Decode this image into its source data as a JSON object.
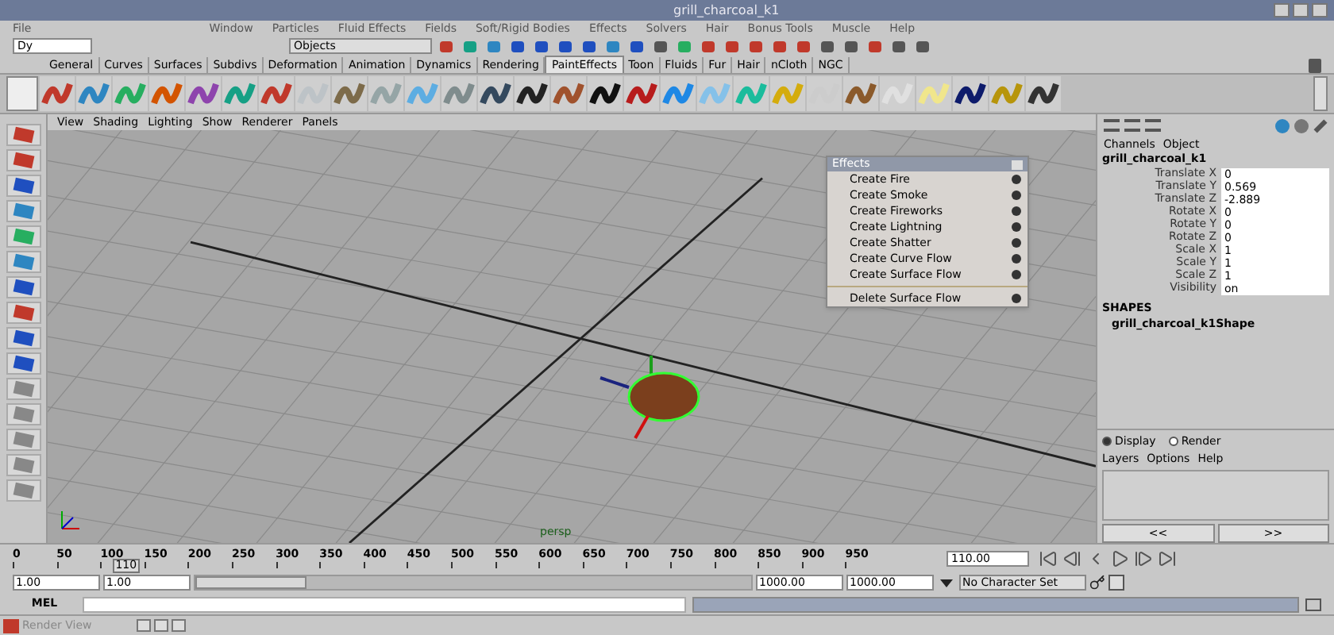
{
  "window": {
    "title": "grill_charcoal_k1"
  },
  "menu_bar": [
    "File",
    "Window",
    "Particles",
    "Fluid Effects",
    "Fields",
    "Soft/Rigid Bodies",
    "Effects",
    "Solvers",
    "Hair",
    "Bonus Tools",
    "Muscle",
    "Help"
  ],
  "status_line": {
    "menu_set": "Dy",
    "selection_field": "Objects"
  },
  "shelf_tabs": [
    {
      "label": "General",
      "selected": false
    },
    {
      "label": "Curves",
      "selected": false
    },
    {
      "label": "Surfaces",
      "selected": false
    },
    {
      "label": "Subdivs",
      "selected": false
    },
    {
      "label": "Deformation",
      "selected": false
    },
    {
      "label": "Animation",
      "selected": false
    },
    {
      "label": "Dynamics",
      "selected": false
    },
    {
      "label": "Rendering",
      "selected": false
    },
    {
      "label": "PaintEffects",
      "selected": true
    },
    {
      "label": "Toon",
      "selected": false
    },
    {
      "label": "Fluids",
      "selected": false
    },
    {
      "label": "Fur",
      "selected": false
    },
    {
      "label": "Hair",
      "selected": false
    },
    {
      "label": "nCloth",
      "selected": false
    },
    {
      "label": "NGC",
      "selected": false
    }
  ],
  "viewport": {
    "menus": [
      "View",
      "Shading",
      "Lighting",
      "Show",
      "Renderer",
      "Panels"
    ],
    "camera_label": "persp"
  },
  "effects_menu": {
    "title": "Effects",
    "items": [
      {
        "label": "Create Fire",
        "kind": "item"
      },
      {
        "label": "Create Smoke",
        "kind": "item"
      },
      {
        "label": "Create Fireworks",
        "kind": "item"
      },
      {
        "label": "Create Lightning",
        "kind": "item"
      },
      {
        "label": "Create Shatter",
        "kind": "item"
      },
      {
        "label": "Create Curve Flow",
        "kind": "item"
      },
      {
        "label": "Create Surface Flow",
        "kind": "item"
      },
      {
        "kind": "separator"
      },
      {
        "label": "Delete Surface Flow",
        "kind": "item"
      }
    ]
  },
  "channel_box": {
    "tabs": [
      "Channels",
      "Object"
    ],
    "object": "grill_charcoal_k1",
    "channels": [
      {
        "name": "Translate X",
        "value": "0"
      },
      {
        "name": "Translate Y",
        "value": "0.569"
      },
      {
        "name": "Translate Z",
        "value": "-2.889"
      },
      {
        "name": "Rotate X",
        "value": "0"
      },
      {
        "name": "Rotate Y",
        "value": "0"
      },
      {
        "name": "Rotate Z",
        "value": "0"
      },
      {
        "name": "Scale X",
        "value": "1"
      },
      {
        "name": "Scale Y",
        "value": "1"
      },
      {
        "name": "Scale Z",
        "value": "1"
      },
      {
        "name": "Visibility",
        "value": "on"
      }
    ],
    "shapes_heading": "SHAPES",
    "shape": "grill_charcoal_k1Shape"
  },
  "layer_editor": {
    "modes": [
      {
        "label": "Display",
        "selected": true
      },
      {
        "label": "Render",
        "selected": false
      }
    ],
    "menus": [
      "Layers",
      "Options",
      "Help"
    ],
    "scroll_buttons": [
      "<<",
      ">>"
    ]
  },
  "timeline": {
    "ticks": [
      "0",
      "50",
      "100",
      "150",
      "200",
      "250",
      "300",
      "350",
      "400",
      "450",
      "500",
      "550",
      "600",
      "650",
      "700",
      "750",
      "800",
      "850",
      "900",
      "950"
    ],
    "current_frame": "110",
    "level": 0.11,
    "current_time": "110.00"
  },
  "range_slider": {
    "level": 0.2,
    "start": "1.00",
    "playback_start": "1.00",
    "playback_end": "1000.00",
    "end": "1000.00",
    "character_set": "No Character Set"
  },
  "command_line": {
    "label": "MEL"
  },
  "taskbar": {
    "window": "Render View"
  }
}
